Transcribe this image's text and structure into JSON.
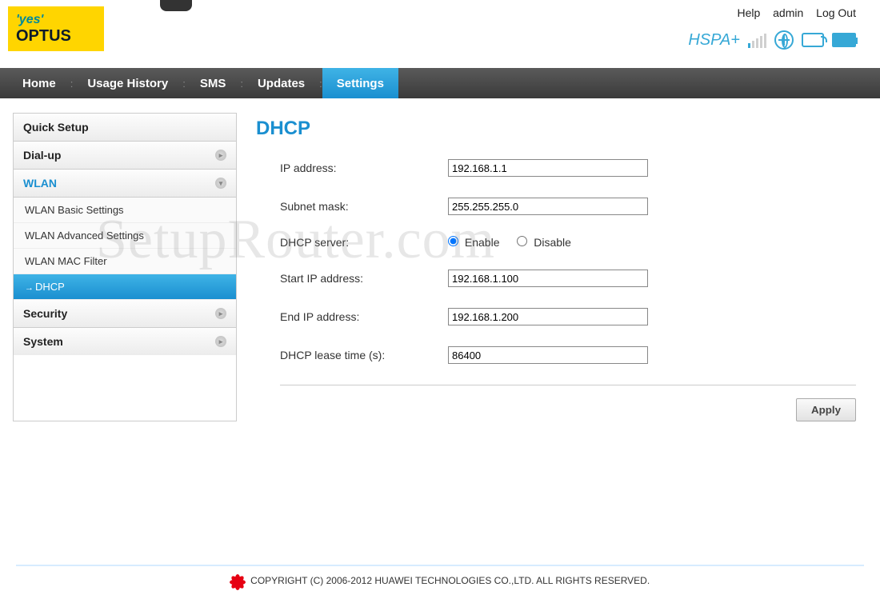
{
  "logo": {
    "line1": "'yes'",
    "line2": "OPTUS"
  },
  "header_links": {
    "help": "Help",
    "user": "admin",
    "logout": "Log Out"
  },
  "status": {
    "network": "HSPA+"
  },
  "nav": {
    "home": "Home",
    "usage": "Usage History",
    "sms": "SMS",
    "updates": "Updates",
    "settings": "Settings"
  },
  "sidebar": {
    "quick_setup": "Quick Setup",
    "dialup": "Dial-up",
    "wlan": "WLAN",
    "wlan_items": {
      "basic": "WLAN Basic Settings",
      "advanced": "WLAN Advanced Settings",
      "mac": "WLAN MAC Filter",
      "dhcp": "DHCP"
    },
    "security": "Security",
    "system": "System"
  },
  "page": {
    "title": "DHCP",
    "labels": {
      "ip": "IP address:",
      "subnet": "Subnet mask:",
      "dhcp_server": "DHCP server:",
      "start_ip": "Start IP address:",
      "end_ip": "End IP address:",
      "lease": "DHCP lease time (s):"
    },
    "values": {
      "ip": "192.168.1.1",
      "subnet": "255.255.255.0",
      "start_ip": "192.168.1.100",
      "end_ip": "192.168.1.200",
      "lease": "86400"
    },
    "radio": {
      "enable": "Enable",
      "disable": "Disable",
      "selected": "enable"
    },
    "apply": "Apply"
  },
  "watermark": "SetupRouter.com",
  "footer": "COPYRIGHT (C) 2006-2012 HUAWEI TECHNOLOGIES CO.,LTD. ALL RIGHTS RESERVED."
}
